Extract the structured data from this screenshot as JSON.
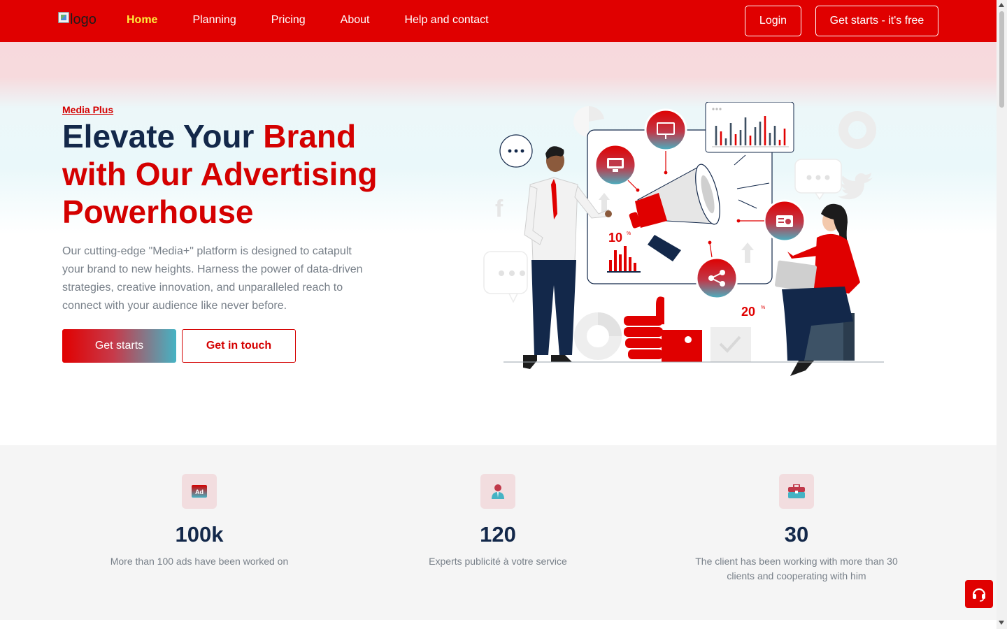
{
  "nav": {
    "logo_alt": "logo",
    "links": [
      {
        "label": "Home",
        "active": true
      },
      {
        "label": "Planning",
        "active": false
      },
      {
        "label": "Pricing",
        "active": false
      },
      {
        "label": "About",
        "active": false
      },
      {
        "label": "Help and contact",
        "active": false
      }
    ],
    "login_label": "Login",
    "cta_label": "Get starts - it's free"
  },
  "hero": {
    "eyebrow": "Media Plus",
    "headline_dark": "Elevate Your ",
    "headline_accent": "Brand with Our Advertising Powerhouse",
    "description": "Our cutting-edge \"Media+\" platform is designed to catapult your brand to new heights. Harness the power of data-driven strategies, creative innovation, and unparalleled reach to connect with your audience like never before.",
    "primary_button": "Get starts",
    "secondary_button": "Get in touch",
    "illustration": {
      "badge_left": "10",
      "badge_right": "20",
      "badge_unit": "%",
      "icons": [
        "monitor-icon",
        "presentation-board-icon",
        "radio-icon",
        "share-icon",
        "megaphone-icon",
        "thumbs-up-icon",
        "bar-chart-icon",
        "facebook-icon",
        "twitter-icon",
        "chat-bubble-icon"
      ]
    }
  },
  "stats": [
    {
      "icon": "ad-icon",
      "value": "100k",
      "description": "More than 100 ads have been worked on"
    },
    {
      "icon": "expert-user-icon",
      "value": "120",
      "description": "Experts publicité à votre service"
    },
    {
      "icon": "briefcase-icon",
      "value": "30",
      "description": "The client has been working with more than 30 clients and cooperating with him"
    }
  ],
  "support_button_icon": "headset-icon",
  "colors": {
    "brand_red": "#e00000",
    "accent_red": "#d40000",
    "navy": "#13284a",
    "teal": "#45b3c4",
    "active_nav": "#ffeb3b",
    "muted_text": "#777f88"
  }
}
